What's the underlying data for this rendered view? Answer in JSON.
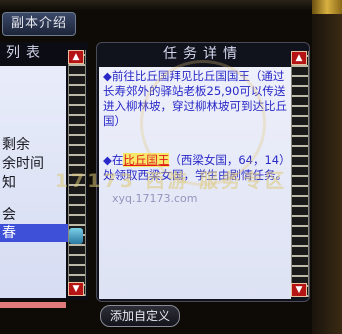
{
  "window": {
    "intro_tab": "副本介绍"
  },
  "list_panel": {
    "header": "列表",
    "items": [
      {
        "label": "剩余",
        "selected": false
      },
      {
        "label": "余时间",
        "selected": false
      },
      {
        "label": "知",
        "selected": false
      },
      {
        "label": "会",
        "selected": false
      },
      {
        "label": "春",
        "selected": true
      }
    ]
  },
  "detail_panel": {
    "header": "任务详情",
    "para1": "◆前往比丘国拜见比丘国国王（通过长寿郊外的驿站老板25,90可以传送进入柳林坡，穿过柳林坡可到达比丘国）",
    "para2_prefix": "◆在",
    "para2_npc": "比丘国王",
    "para2_suffix": "（西梁女国，64，14）处领取西梁女国，学生由剧情任务。"
  },
  "watermark": {
    "line": "17173 西游 服务专区",
    "url": "xyq.17173.com"
  },
  "buttons": {
    "add_custom": "添加自定义"
  },
  "icons": {
    "scroll_up": "triangle-up-icon",
    "scroll_down": "triangle-down-icon",
    "scroll_thumb": "scroll-thumb-icon"
  },
  "colors": {
    "selected_row": "#3e50d8",
    "task_text": "#2828c8",
    "npc_link": "#e01818",
    "scroll_button": "#b51414"
  }
}
